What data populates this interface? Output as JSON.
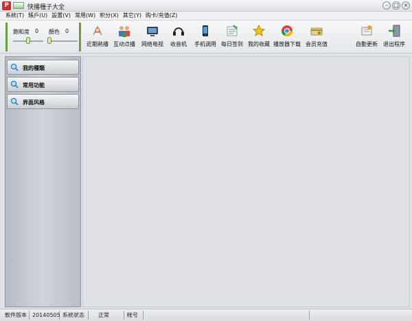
{
  "window": {
    "app_glyph": "P",
    "title": "快播種子大全",
    "controls": {
      "minimize": "–",
      "restore": "□",
      "close": "×"
    }
  },
  "menu": [
    "系統(T)",
    "賬戶(U)",
    "設置(V)",
    "常用(W)",
    "积分(X)",
    "其它(Y)",
    "购卡/充值(Z)"
  ],
  "sliders": {
    "saturation_label": "飽和度",
    "saturation_value": "0",
    "color_label": "顏色",
    "color_value": "0"
  },
  "toolbar": [
    {
      "label": "近期熱播",
      "icon": "hot-icon"
    },
    {
      "label": "互动点播",
      "icon": "people-icon"
    },
    {
      "label": "网络电视",
      "icon": "tv-icon"
    },
    {
      "label": "收音机",
      "icon": "headphones-icon"
    },
    {
      "label": "手机调用",
      "icon": "phone-icon"
    },
    {
      "label": "每日签到",
      "icon": "checkin-icon"
    },
    {
      "label": "我的收藏",
      "icon": "star-icon"
    },
    {
      "label": "播放器下载",
      "icon": "chrome-icon"
    },
    {
      "label": "会员充值",
      "icon": "recharge-icon"
    },
    {
      "label": "自動更新",
      "icon": "update-icon"
    },
    {
      "label": "退出程序",
      "icon": "exit-icon"
    }
  ],
  "side_panel": [
    {
      "label": "我的種類"
    },
    {
      "label": "常用功能"
    },
    {
      "label": "界面风格"
    }
  ],
  "status_bar": [
    {
      "label": "軟件版本"
    },
    {
      "label": "20140505"
    },
    {
      "label": "系統状态"
    },
    {
      "label": "正常"
    },
    {
      "label": "帐号"
    },
    {
      "label": ""
    }
  ],
  "colors": {
    "accent_green": "#6e9b3c",
    "title_icon_red": "#d22c2c",
    "background": "#dfe3e8"
  }
}
